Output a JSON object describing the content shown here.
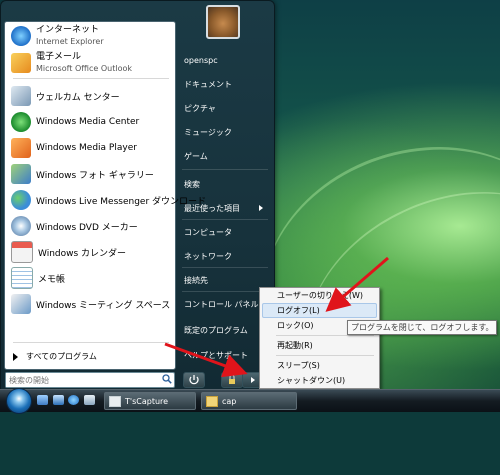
{
  "window_title": "",
  "start_menu": {
    "pinned": [
      {
        "label": "インターネット",
        "sublabel": "Internet Explorer",
        "icon": "ie-icon"
      },
      {
        "label": "電子メール",
        "sublabel": "Microsoft Office Outlook",
        "icon": "outlook-icon"
      }
    ],
    "programs": [
      {
        "label": "ウェルカム センター",
        "icon": "welcome-center-icon"
      },
      {
        "label": "Windows Media Center",
        "icon": "media-center-icon"
      },
      {
        "label": "Windows Media Player",
        "icon": "media-player-icon"
      },
      {
        "label": "Windows フォト ギャラリー",
        "icon": "photo-gallery-icon"
      },
      {
        "label": "Windows Live Messenger ダウンロード",
        "icon": "messenger-icon"
      },
      {
        "label": "Windows DVD メーカー",
        "icon": "dvd-maker-icon"
      },
      {
        "label": "Windows カレンダー",
        "icon": "calendar-icon"
      },
      {
        "label": "メモ帳",
        "icon": "notepad-icon"
      },
      {
        "label": "Windows ミーティング スペース",
        "icon": "meeting-space-icon"
      }
    ],
    "all_programs": "すべてのプログラム",
    "search_placeholder": "検索の開始",
    "right": {
      "user": "openspc",
      "items": [
        "ドキュメント",
        "ピクチャ",
        "ミュージック",
        "ゲーム"
      ],
      "items2": [
        "検索",
        "最近使った項目"
      ],
      "items3": [
        "コンピュータ",
        "ネットワーク"
      ],
      "items4": [
        "接続先"
      ],
      "items5": [
        "コントロール パネル",
        "既定のプログラム",
        "ヘルプとサポート"
      ]
    }
  },
  "context_menu": {
    "items": [
      "ユーザーの切り替え(W)",
      "ログオフ(L)",
      "ロック(O)",
      "再起動(R)",
      "スリープ(S)",
      "シャットダウン(U)"
    ],
    "highlighted": "ログオフ(L)",
    "tooltip": "プログラムを閉じて、ログオフします。"
  },
  "taskbar": {
    "tasks": [
      "T'sCapture",
      "cap"
    ]
  },
  "colors": {
    "highlight": "#dbe9f7",
    "arrow": "#e0141b"
  }
}
